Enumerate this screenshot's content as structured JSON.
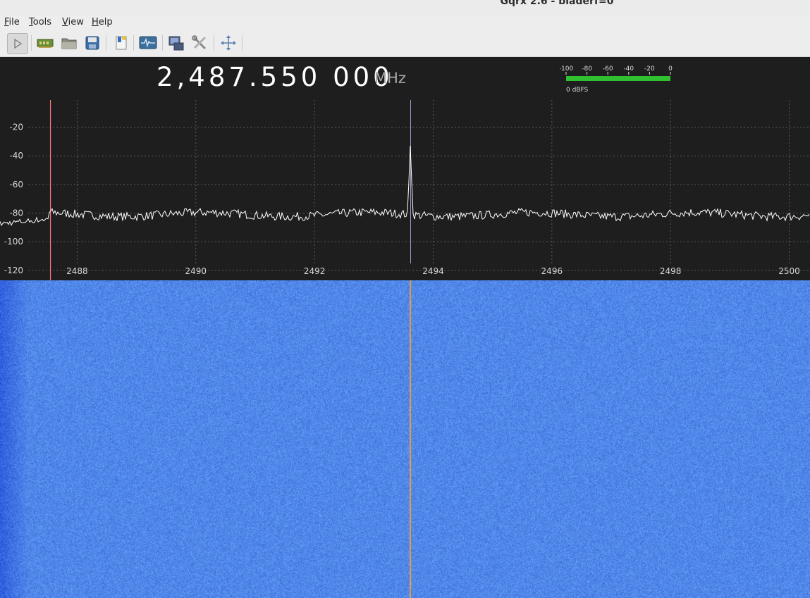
{
  "window": {
    "title": "Gqrx 2.6 - bladerf=0"
  },
  "menu": [
    {
      "accel": "F",
      "rest": "ile"
    },
    {
      "accel": "T",
      "rest": "ools"
    },
    {
      "accel": "V",
      "rest": "iew"
    },
    {
      "accel": "H",
      "rest": "elp"
    }
  ],
  "toolbar": {
    "icons": [
      "play-icon",
      "hardware-icon",
      "open-folder-icon",
      "save-icon",
      "bookmark-icon",
      "waveform-display-icon",
      "remote-control-icon",
      "tools-icon",
      "fullscreen-icon"
    ]
  },
  "receiver": {
    "frequency": "2,487.550 000",
    "unit": "MHz"
  },
  "level_meter": {
    "ticks": [
      "-100",
      "-80",
      "-60",
      "-40",
      "-20",
      "0"
    ],
    "level_fraction": 1.0,
    "label": "0 dBFS",
    "color": "#2fbf2f"
  },
  "chart_data": {
    "type": "line",
    "y_tick_labels": [
      "-20",
      "-40",
      "-60",
      "-80",
      "-100",
      "-120"
    ],
    "y_ticks": [
      -20,
      -40,
      -60,
      -80,
      -100,
      -120
    ],
    "x_tick_labels": [
      "2488",
      "2490",
      "2492",
      "2494",
      "2496",
      "2498",
      "2500"
    ],
    "x_ticks": [
      2488,
      2490,
      2492,
      2494,
      2496,
      2498,
      2500
    ],
    "xlim": [
      2486.7,
      2500.35
    ],
    "ylim": [
      -127,
      -1
    ],
    "noise_floor_db": -81,
    "peak": {
      "x": 2493.62,
      "y": -33
    },
    "center_marker_x": 2493.62,
    "rx_marker_x": 2487.55,
    "grid": true,
    "colors": {
      "trace": "#ffffff",
      "grid": "#5a5a5a",
      "rx_marker": "#ff7b7b",
      "center_marker": "#9aa0c8",
      "waterfall_marker": "#e8a03a"
    }
  },
  "waterfall": {
    "background": "#4a7fe6"
  }
}
